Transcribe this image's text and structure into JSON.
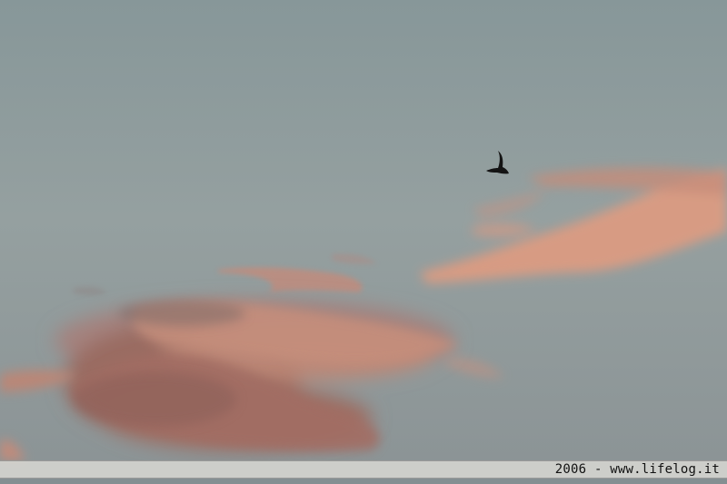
{
  "photo": {
    "subject": "bird-silhouette",
    "colors": {
      "sky_top": "#8a9a9d",
      "sky_mid": "#96a1a1",
      "sky_bottom": "#8c9497",
      "cloud_pink": "#e29a80",
      "cloud_shadow": "#8e6a62",
      "bird": "#141414",
      "caption_bg": "#d6d6d2"
    }
  },
  "caption": {
    "text": "2006 - www.lifelog.it"
  }
}
